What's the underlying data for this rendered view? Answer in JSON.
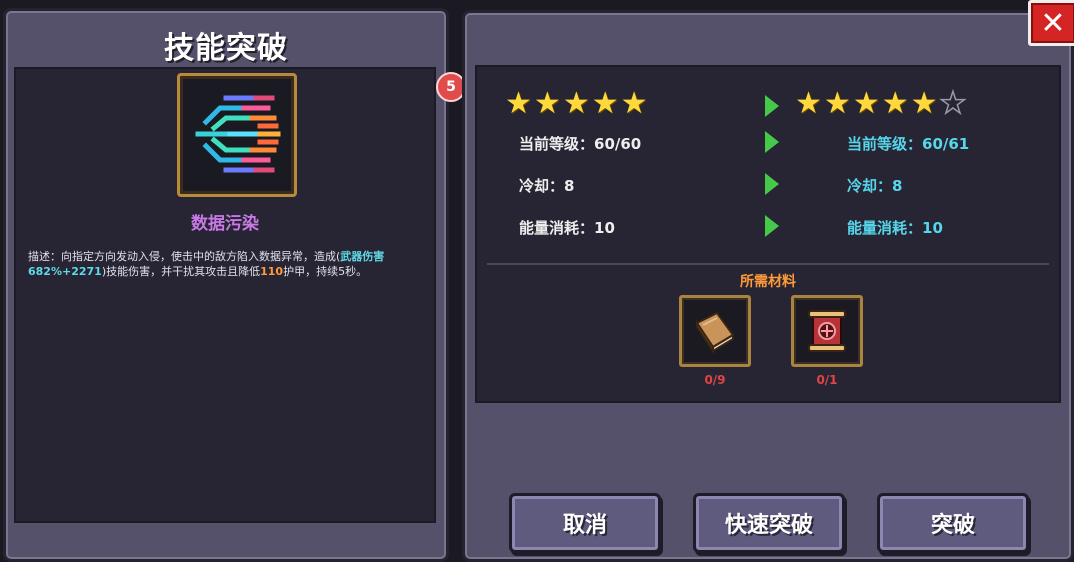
{
  "left_panel": {
    "title": "技能突破",
    "skill_name": "数据污染",
    "badge_count": "5",
    "description": {
      "prefix": "描述：向指定方向发动入侵，使击中的敌方陷入数据异常，造成(",
      "damage": "武器伤害682%+2271",
      "middle": ")技能伤害，并干扰其攻击且降低",
      "armor_value": "110",
      "suffix": "护甲，持续5秒。"
    }
  },
  "right_panel": {
    "current": {
      "stars_filled": 5,
      "stars_total": 5,
      "level": "当前等级：60/60",
      "cooldown": "冷却：8",
      "energy": "能量消耗：10"
    },
    "next": {
      "stars_filled": 5,
      "stars_total": 6,
      "level": "当前等级：60/61",
      "cooldown": "冷却：8",
      "energy": "能量消耗：10"
    },
    "materials_title": "所需材料",
    "materials": [
      {
        "icon": "book-icon",
        "count": "0/9"
      },
      {
        "icon": "scroll-icon",
        "count": "0/1"
      }
    ]
  },
  "buttons": {
    "cancel": "取消",
    "quick_breakthrough": "快速突破",
    "breakthrough": "突破"
  },
  "close_label": "✕",
  "colors": {
    "accent_cyan": "#56d6ea",
    "accent_orange": "#ff9a3a",
    "skill_name": "#c879e6",
    "count_red": "#e04444",
    "arrow_green": "#45c94a"
  }
}
